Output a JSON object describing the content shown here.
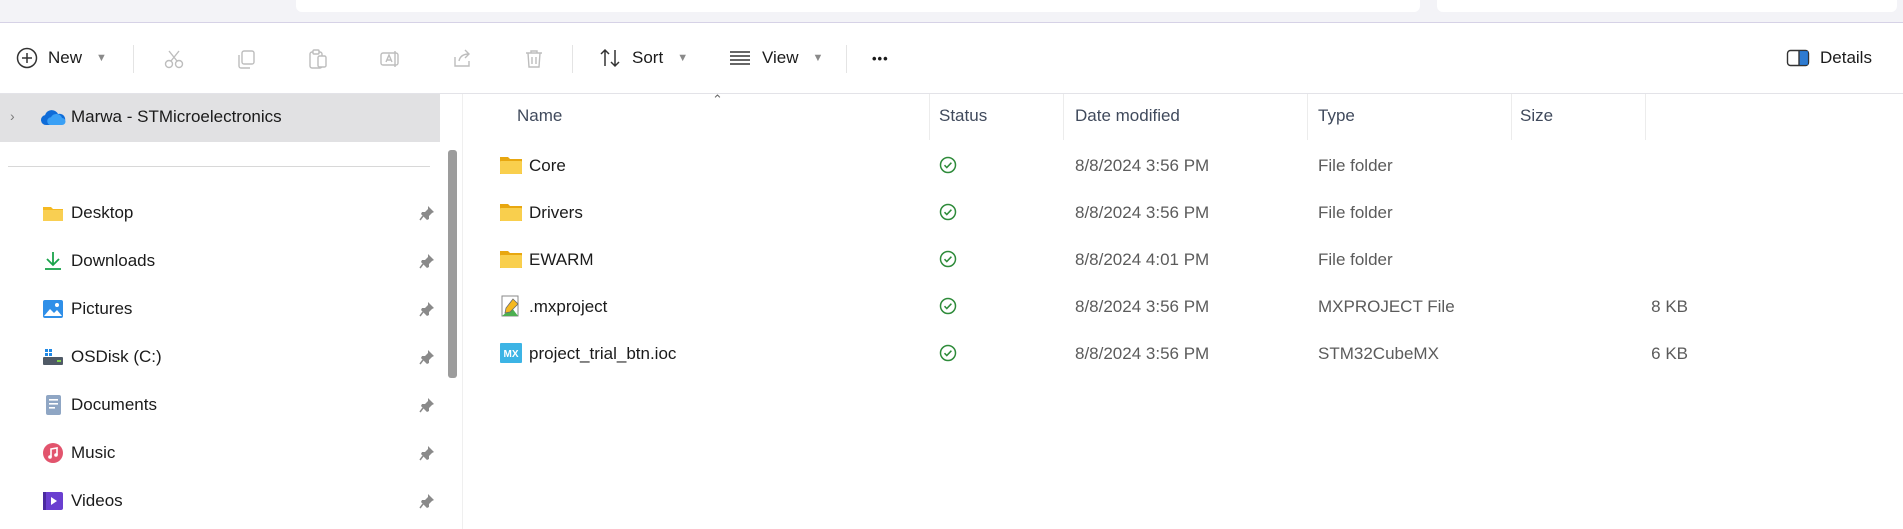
{
  "toolbar": {
    "new_label": "New",
    "sort_label": "Sort",
    "view_label": "View",
    "more_label": "•••",
    "details_label": "Details"
  },
  "sidebar": {
    "home_label": "Marwa - STMicroelectronics",
    "items": [
      {
        "label": "Desktop",
        "icon": "desktop-folder-icon"
      },
      {
        "label": "Downloads",
        "icon": "download-arrow-icon"
      },
      {
        "label": "Pictures",
        "icon": "pictures-icon"
      },
      {
        "label": "OSDisk (C:)",
        "icon": "drive-icon"
      },
      {
        "label": "Documents",
        "icon": "documents-icon"
      },
      {
        "label": "Music",
        "icon": "music-icon"
      },
      {
        "label": "Videos",
        "icon": "videos-icon"
      }
    ]
  },
  "list": {
    "columns": {
      "name": "Name",
      "status": "Status",
      "date": "Date modified",
      "type": "Type",
      "size": "Size"
    },
    "rows": [
      {
        "name": "Core",
        "date": "8/8/2024 3:56 PM",
        "type": "File folder",
        "size": "",
        "icon": "folder-icon"
      },
      {
        "name": "Drivers",
        "date": "8/8/2024 3:56 PM",
        "type": "File folder",
        "size": "",
        "icon": "folder-icon"
      },
      {
        "name": "EWARM",
        "date": "8/8/2024 4:01 PM",
        "type": "File folder",
        "size": "",
        "icon": "folder-icon"
      },
      {
        "name": ".mxproject",
        "date": "8/8/2024 3:56 PM",
        "type": "MXPROJECT File",
        "size": "8 KB",
        "icon": "mxproject-file-icon"
      },
      {
        "name": "project_trial_btn.ioc",
        "date": "8/8/2024 3:56 PM",
        "type": "STM32CubeMX",
        "size": "6 KB",
        "icon": "stm32cubemx-file-icon"
      }
    ]
  },
  "colors": {
    "folder": "#f7c84b",
    "status_green": "#2e8b3a",
    "selection": "#e1e1e3",
    "accent": "#0a64c8"
  }
}
